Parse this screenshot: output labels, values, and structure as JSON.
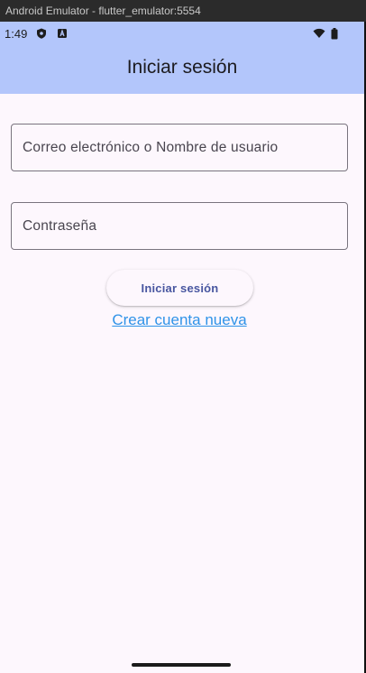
{
  "window": {
    "title": "Android Emulator - flutter_emulator:5554"
  },
  "status_bar": {
    "time": "1:49",
    "icons": [
      "shield-icon",
      "a-badge-icon",
      "wifi-icon",
      "battery-icon"
    ]
  },
  "app_bar": {
    "title": "Iniciar sesión"
  },
  "form": {
    "username_placeholder": "Correo electrónico o Nombre de usuario",
    "password_placeholder": "Contraseña",
    "login_button_label": "Iniciar sesión",
    "create_account_link": "Crear cuenta nueva"
  },
  "colors": {
    "app_bar_bg": "#b3c6fb",
    "screen_bg": "#fdf7fd",
    "link": "#2f93e8",
    "button_text": "#4856a0"
  }
}
